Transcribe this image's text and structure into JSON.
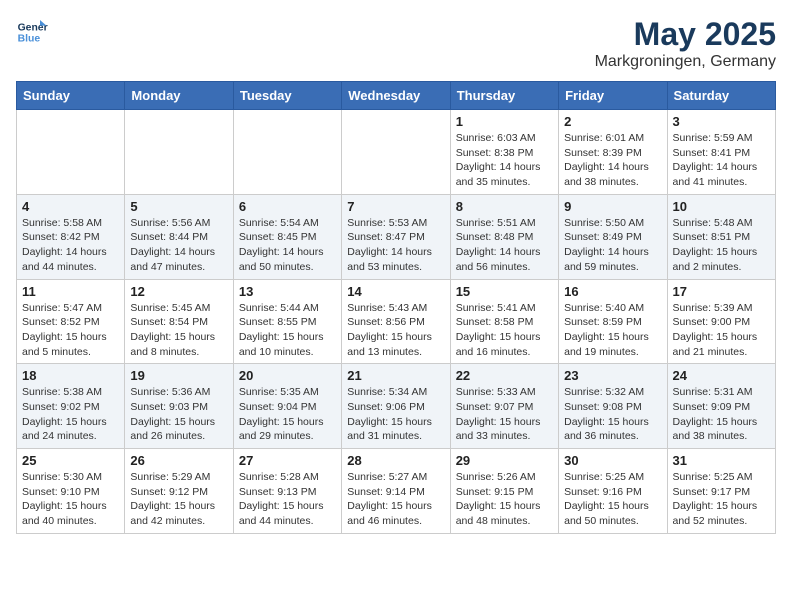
{
  "header": {
    "logo_line1": "General",
    "logo_line2": "Blue",
    "month": "May 2025",
    "location": "Markgroningen, Germany"
  },
  "weekdays": [
    "Sunday",
    "Monday",
    "Tuesday",
    "Wednesday",
    "Thursday",
    "Friday",
    "Saturday"
  ],
  "weeks": [
    [
      {
        "day": "",
        "detail": ""
      },
      {
        "day": "",
        "detail": ""
      },
      {
        "day": "",
        "detail": ""
      },
      {
        "day": "",
        "detail": ""
      },
      {
        "day": "1",
        "detail": "Sunrise: 6:03 AM\nSunset: 8:38 PM\nDaylight: 14 hours\nand 35 minutes."
      },
      {
        "day": "2",
        "detail": "Sunrise: 6:01 AM\nSunset: 8:39 PM\nDaylight: 14 hours\nand 38 minutes."
      },
      {
        "day": "3",
        "detail": "Sunrise: 5:59 AM\nSunset: 8:41 PM\nDaylight: 14 hours\nand 41 minutes."
      }
    ],
    [
      {
        "day": "4",
        "detail": "Sunrise: 5:58 AM\nSunset: 8:42 PM\nDaylight: 14 hours\nand 44 minutes."
      },
      {
        "day": "5",
        "detail": "Sunrise: 5:56 AM\nSunset: 8:44 PM\nDaylight: 14 hours\nand 47 minutes."
      },
      {
        "day": "6",
        "detail": "Sunrise: 5:54 AM\nSunset: 8:45 PM\nDaylight: 14 hours\nand 50 minutes."
      },
      {
        "day": "7",
        "detail": "Sunrise: 5:53 AM\nSunset: 8:47 PM\nDaylight: 14 hours\nand 53 minutes."
      },
      {
        "day": "8",
        "detail": "Sunrise: 5:51 AM\nSunset: 8:48 PM\nDaylight: 14 hours\nand 56 minutes."
      },
      {
        "day": "9",
        "detail": "Sunrise: 5:50 AM\nSunset: 8:49 PM\nDaylight: 14 hours\nand 59 minutes."
      },
      {
        "day": "10",
        "detail": "Sunrise: 5:48 AM\nSunset: 8:51 PM\nDaylight: 15 hours\nand 2 minutes."
      }
    ],
    [
      {
        "day": "11",
        "detail": "Sunrise: 5:47 AM\nSunset: 8:52 PM\nDaylight: 15 hours\nand 5 minutes."
      },
      {
        "day": "12",
        "detail": "Sunrise: 5:45 AM\nSunset: 8:54 PM\nDaylight: 15 hours\nand 8 minutes."
      },
      {
        "day": "13",
        "detail": "Sunrise: 5:44 AM\nSunset: 8:55 PM\nDaylight: 15 hours\nand 10 minutes."
      },
      {
        "day": "14",
        "detail": "Sunrise: 5:43 AM\nSunset: 8:56 PM\nDaylight: 15 hours\nand 13 minutes."
      },
      {
        "day": "15",
        "detail": "Sunrise: 5:41 AM\nSunset: 8:58 PM\nDaylight: 15 hours\nand 16 minutes."
      },
      {
        "day": "16",
        "detail": "Sunrise: 5:40 AM\nSunset: 8:59 PM\nDaylight: 15 hours\nand 19 minutes."
      },
      {
        "day": "17",
        "detail": "Sunrise: 5:39 AM\nSunset: 9:00 PM\nDaylight: 15 hours\nand 21 minutes."
      }
    ],
    [
      {
        "day": "18",
        "detail": "Sunrise: 5:38 AM\nSunset: 9:02 PM\nDaylight: 15 hours\nand 24 minutes."
      },
      {
        "day": "19",
        "detail": "Sunrise: 5:36 AM\nSunset: 9:03 PM\nDaylight: 15 hours\nand 26 minutes."
      },
      {
        "day": "20",
        "detail": "Sunrise: 5:35 AM\nSunset: 9:04 PM\nDaylight: 15 hours\nand 29 minutes."
      },
      {
        "day": "21",
        "detail": "Sunrise: 5:34 AM\nSunset: 9:06 PM\nDaylight: 15 hours\nand 31 minutes."
      },
      {
        "day": "22",
        "detail": "Sunrise: 5:33 AM\nSunset: 9:07 PM\nDaylight: 15 hours\nand 33 minutes."
      },
      {
        "day": "23",
        "detail": "Sunrise: 5:32 AM\nSunset: 9:08 PM\nDaylight: 15 hours\nand 36 minutes."
      },
      {
        "day": "24",
        "detail": "Sunrise: 5:31 AM\nSunset: 9:09 PM\nDaylight: 15 hours\nand 38 minutes."
      }
    ],
    [
      {
        "day": "25",
        "detail": "Sunrise: 5:30 AM\nSunset: 9:10 PM\nDaylight: 15 hours\nand 40 minutes."
      },
      {
        "day": "26",
        "detail": "Sunrise: 5:29 AM\nSunset: 9:12 PM\nDaylight: 15 hours\nand 42 minutes."
      },
      {
        "day": "27",
        "detail": "Sunrise: 5:28 AM\nSunset: 9:13 PM\nDaylight: 15 hours\nand 44 minutes."
      },
      {
        "day": "28",
        "detail": "Sunrise: 5:27 AM\nSunset: 9:14 PM\nDaylight: 15 hours\nand 46 minutes."
      },
      {
        "day": "29",
        "detail": "Sunrise: 5:26 AM\nSunset: 9:15 PM\nDaylight: 15 hours\nand 48 minutes."
      },
      {
        "day": "30",
        "detail": "Sunrise: 5:25 AM\nSunset: 9:16 PM\nDaylight: 15 hours\nand 50 minutes."
      },
      {
        "day": "31",
        "detail": "Sunrise: 5:25 AM\nSunset: 9:17 PM\nDaylight: 15 hours\nand 52 minutes."
      }
    ]
  ]
}
